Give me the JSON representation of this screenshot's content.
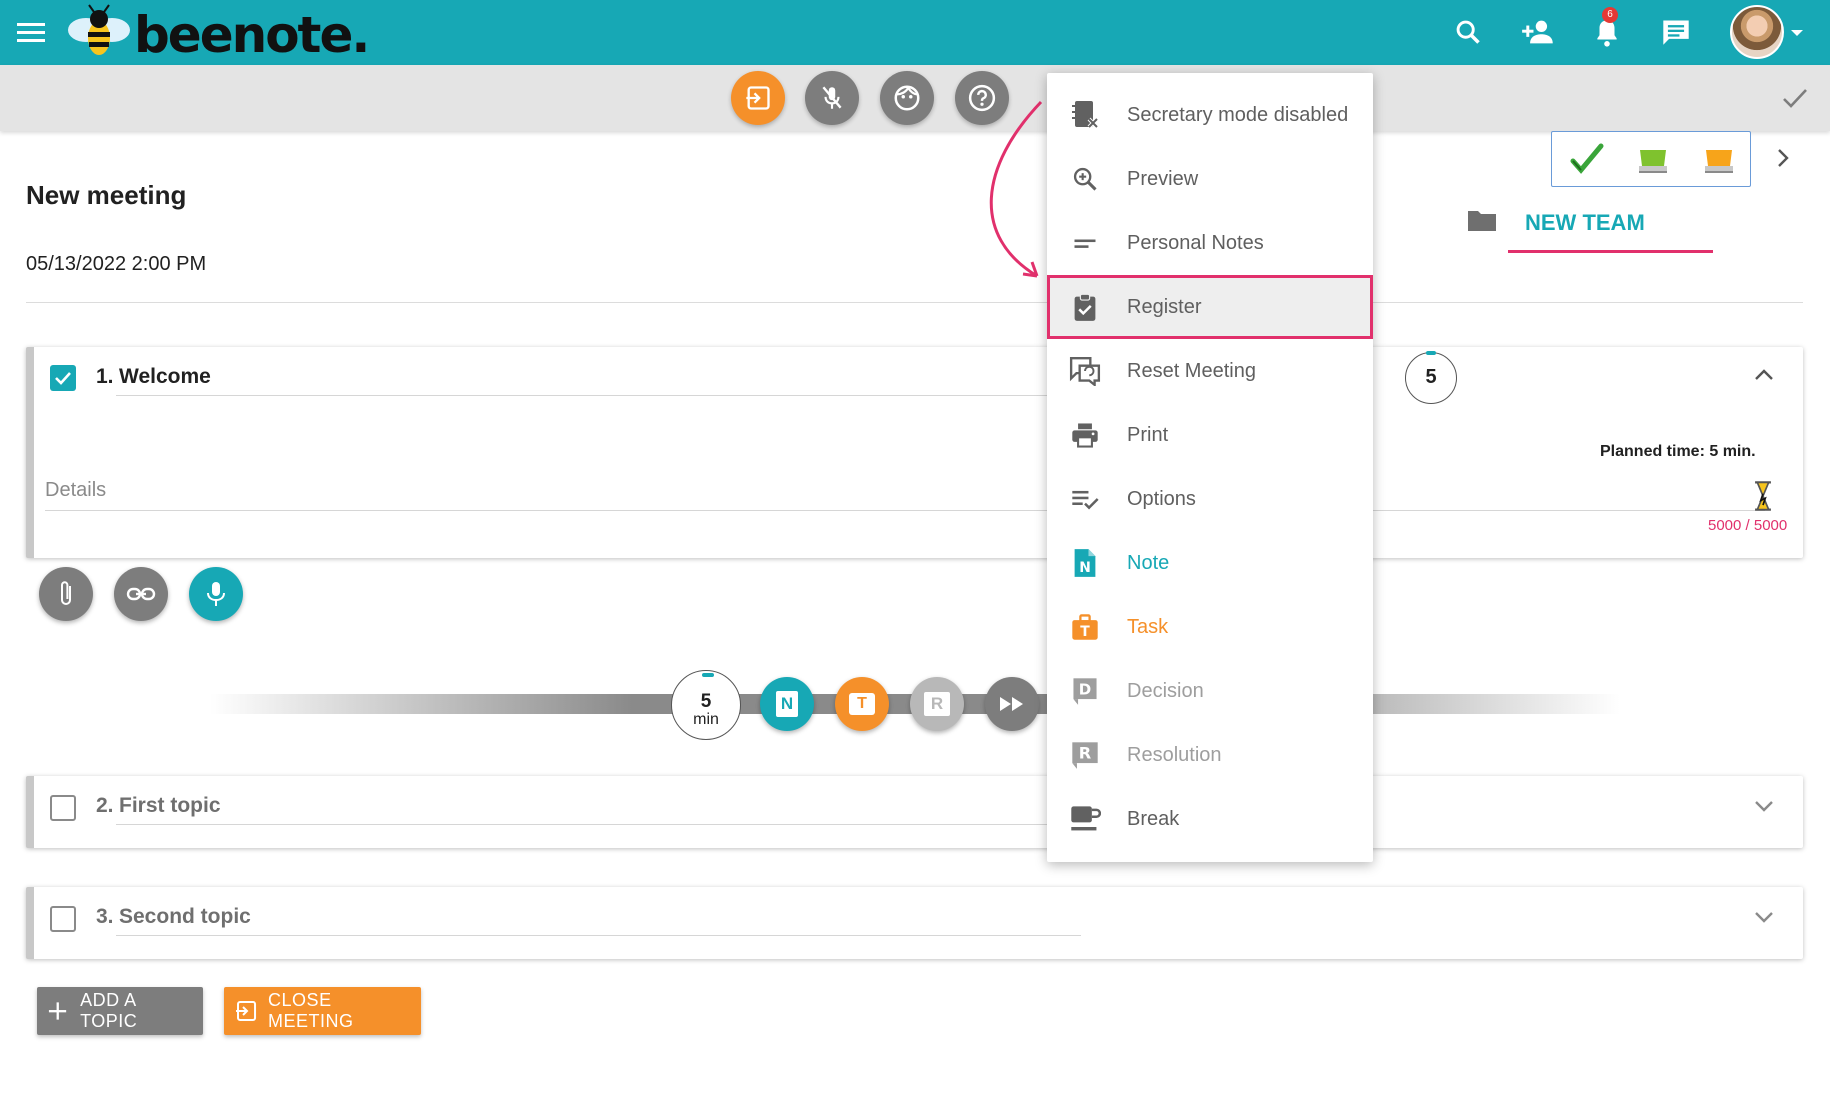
{
  "app": {
    "logo_text": "beenote.",
    "notification_count": "6"
  },
  "meeting": {
    "title": "New meeting",
    "date": "05/13/2022 2:00 PM",
    "team": "NEW TEAM"
  },
  "topics": [
    {
      "number": "1.",
      "title": "Welcome",
      "checked": true,
      "details_placeholder": "Details",
      "timer_value": "5",
      "planned_time": "Planned time: 5 min.",
      "char_count": "5000 / 5000"
    },
    {
      "number": "2.",
      "title": "First topic",
      "checked": false
    },
    {
      "number": "3.",
      "title": "Second topic",
      "checked": false
    }
  ],
  "timeline": {
    "timer_value": "5",
    "timer_unit": "min",
    "note_letter": "N",
    "task_letter": "T",
    "resolution_letter": "R"
  },
  "menu": {
    "items": [
      {
        "label": "Secretary mode disabled",
        "icon": "secretary-off-icon",
        "color": "#5f5f5f"
      },
      {
        "label": "Preview",
        "icon": "zoom-in-icon",
        "color": "#5f5f5f"
      },
      {
        "label": "Personal Notes",
        "icon": "short-text-icon",
        "color": "#5f5f5f"
      },
      {
        "label": "Register",
        "icon": "clipboard-check-icon",
        "color": "#5f5f5f"
      },
      {
        "label": "Reset Meeting",
        "icon": "reset-chat-icon",
        "color": "#5f5f5f"
      },
      {
        "label": "Print",
        "icon": "printer-icon",
        "color": "#5f5f5f"
      },
      {
        "label": "Options",
        "icon": "playlist-check-icon",
        "color": "#5f5f5f"
      },
      {
        "label": "Note",
        "icon": "note-icon",
        "color": "#17a8b5"
      },
      {
        "label": "Task",
        "icon": "task-icon",
        "color": "#f5902a"
      },
      {
        "label": "Decision",
        "icon": "decision-icon",
        "color": "#9e9e9e"
      },
      {
        "label": "Resolution",
        "icon": "resolution-icon",
        "color": "#9e9e9e"
      },
      {
        "label": "Break",
        "icon": "coffee-icon",
        "color": "#5f5f5f"
      }
    ]
  },
  "buttons": {
    "add_topic": "ADD A TOPIC",
    "close_meeting": "CLOSE MEETING"
  },
  "colors": {
    "brand": "#17a8b5",
    "accent_orange": "#f5902a",
    "highlight_pink": "#e1306c",
    "toolbar_gray": "#e4e4e4"
  }
}
